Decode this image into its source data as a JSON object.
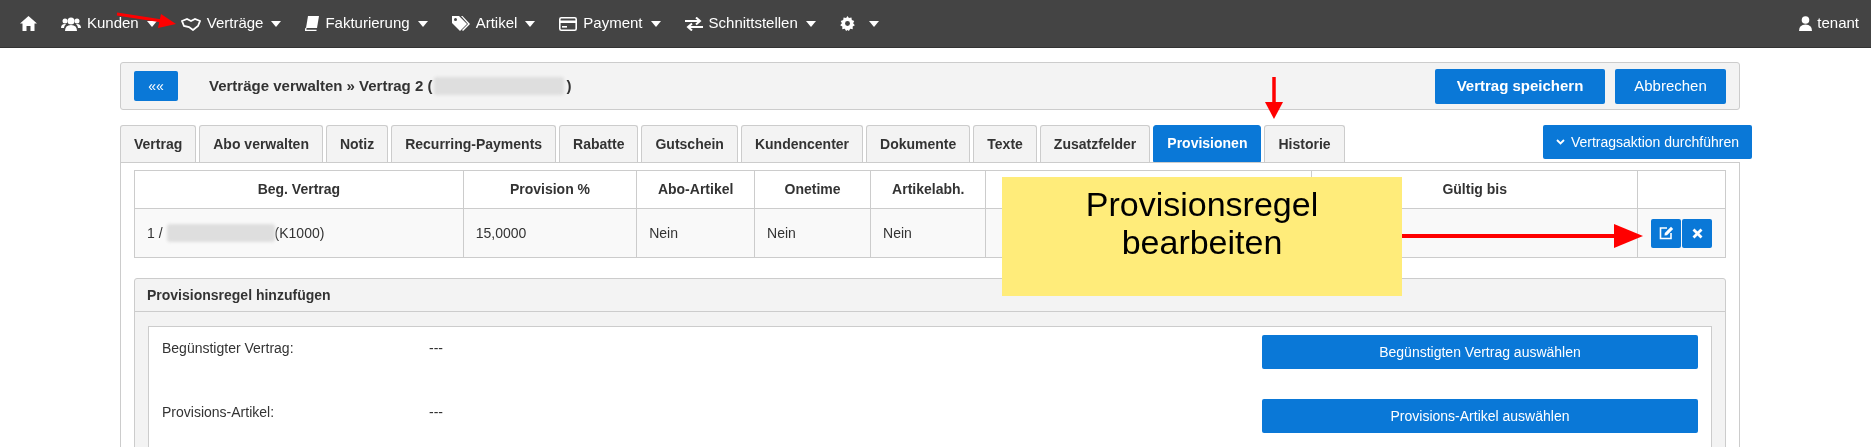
{
  "nav": {
    "items": [
      {
        "kind": "home"
      },
      {
        "kind": "users",
        "label": "Kunden",
        "caret": true
      },
      {
        "kind": "handshake",
        "label": "Verträge",
        "caret": true
      },
      {
        "kind": "book",
        "label": "Fakturierung",
        "caret": true
      },
      {
        "kind": "tags",
        "label": "Artikel",
        "caret": true
      },
      {
        "kind": "card",
        "label": "Payment",
        "caret": true
      },
      {
        "kind": "exchange",
        "label": "Schnittstellen",
        "caret": true
      },
      {
        "kind": "gear",
        "caret": true
      }
    ],
    "user": "tenant"
  },
  "header": {
    "back": "««",
    "title": "Verträge verwalten » Vertrag 2 (",
    "title_end": ")",
    "buttons": [
      {
        "label": "Vertrag speichern",
        "kind": "primary"
      },
      {
        "label": "Abbrechen",
        "kind": "secondary"
      }
    ]
  },
  "tabs": [
    {
      "label": "Vertrag",
      "selected": false
    },
    {
      "label": "Abo verwalten",
      "selected": false
    },
    {
      "label": "Notiz",
      "selected": false
    },
    {
      "label": "Recurring-Payments",
      "selected": false
    },
    {
      "label": "Rabatte",
      "selected": false
    },
    {
      "label": "Gutschein",
      "selected": false
    },
    {
      "label": "Kundencenter",
      "selected": false
    },
    {
      "label": "Dokumente",
      "selected": false
    },
    {
      "label": "Texte",
      "selected": false
    },
    {
      "label": "Zusatzfelder",
      "selected": false
    },
    {
      "label": "Provisionen",
      "selected": true
    },
    {
      "label": "Historie",
      "selected": false
    }
  ],
  "action_button": "Vertragsaktion durchführen",
  "table": {
    "columns": [
      {
        "kind": "text",
        "label": "Beg. Vertrag"
      },
      {
        "kind": "text",
        "label": "Provision %"
      },
      {
        "kind": "text",
        "label": "Abo-Artikel"
      },
      {
        "kind": "text",
        "label": "Onetime"
      },
      {
        "kind": "text",
        "label": "Artikelabh."
      },
      {
        "kind": "covered"
      },
      {
        "kind": "text",
        "label": "Gültig bis"
      },
      {
        "kind": "actions"
      }
    ],
    "rows": [
      {
        "cells": [
          {
            "before": "1 /",
            "after": "(K1000)"
          },
          {
            "text": "15,0000"
          },
          {
            "text": "Nein"
          },
          {
            "text": "Nein"
          },
          {
            "text": "Nein"
          }
        ]
      }
    ]
  },
  "form": {
    "title": "Provisionsregel hinzufügen",
    "rows": [
      {
        "label": "Begünstigter Vertrag:",
        "value": "---",
        "button": "Begünstigten Vertrag auswählen"
      },
      {
        "label": "Provisions-Artikel:",
        "value": "---",
        "button": "Provisions-Artikel auswählen"
      }
    ]
  },
  "callout": {
    "text": "Provisionsregel bearbeiten"
  }
}
